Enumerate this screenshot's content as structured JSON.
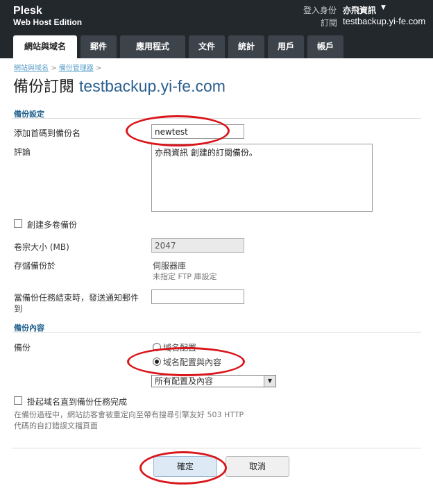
{
  "app": {
    "brand_name": "Plesk",
    "brand_edition": "Web Host Edition",
    "login_label": "登入身份",
    "login_user": "亦飛資訊",
    "subscription_label": "訂閱",
    "subscription_domain": "testbackup.yi-fe.com"
  },
  "tabs": [
    {
      "label": "網站與域名",
      "active": true
    },
    {
      "label": "郵件",
      "active": false
    },
    {
      "label": "應用程式",
      "active": false
    },
    {
      "label": "文件",
      "active": false
    },
    {
      "label": "統計",
      "active": false
    },
    {
      "label": "用戶",
      "active": false
    },
    {
      "label": "帳戶",
      "active": false
    }
  ],
  "breadcrumb": {
    "items": [
      "網站與域名",
      "備份管理器"
    ],
    "separator": ">"
  },
  "page": {
    "title": "備份訂閱",
    "title_domain": "testbackup.yi-fe.com"
  },
  "backup_settings": {
    "section_title": "備份設定",
    "prefix_label": "添加首碼到備份名",
    "prefix_value": "newtest",
    "comment_label": "評論",
    "comment_value": "亦飛資訊 創建的訂閱備份。",
    "multivolume_label": "創建多卷備份",
    "multivolume_checked": false,
    "volume_size_label": "卷宗大小 (MB)",
    "volume_size_value": "2047",
    "storage_label": "存儲備份於",
    "storage_value": "伺服器庫",
    "storage_hint": "未指定 FTP 庫設定",
    "notify_label_line1": "當備份任務結束時，發送通知郵件",
    "notify_label_line2": "到",
    "notify_value": ""
  },
  "backup_content": {
    "section_title": "備份內容",
    "backup_label": "備份",
    "option_config": "域名配置",
    "option_config_content": "域名配置與內容",
    "selected_option": "域名配置與內容",
    "content_select_value": "所有配置及內容",
    "suspend_label": "掛起域名直到備份任務完成",
    "suspend_checked": false,
    "suspend_hint_line1": "在備份過程中，網站訪客會被重定向至帶有搜尋引擎友好 503 HTTP",
    "suspend_hint_line2": "代碼的自訂錯誤文檔頁面"
  },
  "buttons": {
    "ok_label": "確定",
    "cancel_label": "取消"
  },
  "colors": {
    "header_bg": "#23282d",
    "tab_bg": "#3d434a",
    "section_title": "#1c5f8d",
    "annotation_red": "#d9161c",
    "primary_button_bg": "#dde9f4"
  }
}
